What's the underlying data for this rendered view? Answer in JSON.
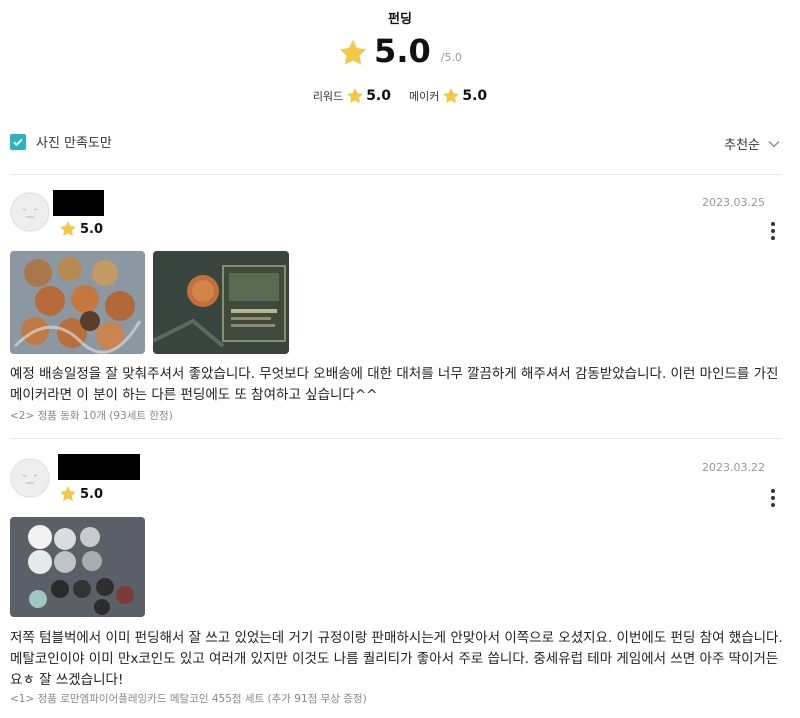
{
  "header": {
    "title": "펀딩",
    "overall_score": "5.0",
    "overall_max": "/5.0",
    "reward_label": "리워드",
    "reward_score": "5.0",
    "maker_label": "메이커",
    "maker_score": "5.0"
  },
  "filter": {
    "photo_only_label": "사진 만족도만",
    "photo_only_checked": true,
    "sort_label": "추천순"
  },
  "colors": {
    "star": "#f6c744",
    "accent": "#2bb3c0"
  },
  "reviews": [
    {
      "rating": "5.0",
      "date": "2023.03.25",
      "text": "예정 배송일정을 잘 맞춰주셔서 좋았습니다. 무엇보다 오배송에 대한 대처를 너무 깔끔하게 해주셔서 감동받았습니다. 이런 마인드를 가진 메이커라면 이 분이 하는 다른 펀딩에도 또 참여하고 싶습니다^^",
      "option": "<2> 정품 동화 10개 (93세트 한정)"
    },
    {
      "rating": "5.0",
      "date": "2023.03.22",
      "text": "저쪽 텀블벅에서 이미 펀딩해서 잘 쓰고 있었는데 거기 규정이랑 판매하시는게 안맞아서 이쪽으로 오셨지요. 이번에도 펀딩 참여 했습니다. 메탈코인이야 이미 만x코인도 있고 여러개 있지만 이것도 나름 퀄리티가 좋아서 주로 씁니다. 중세유럽 테마 게임에서 쓰면 아주 딱이거든요ㅎ 잘 쓰겠습니다!",
      "option": "<1> 정품 로만엠파이어플레잉카드 메탈코인 455점 세트 (추가 91점 무상 증정)"
    }
  ]
}
